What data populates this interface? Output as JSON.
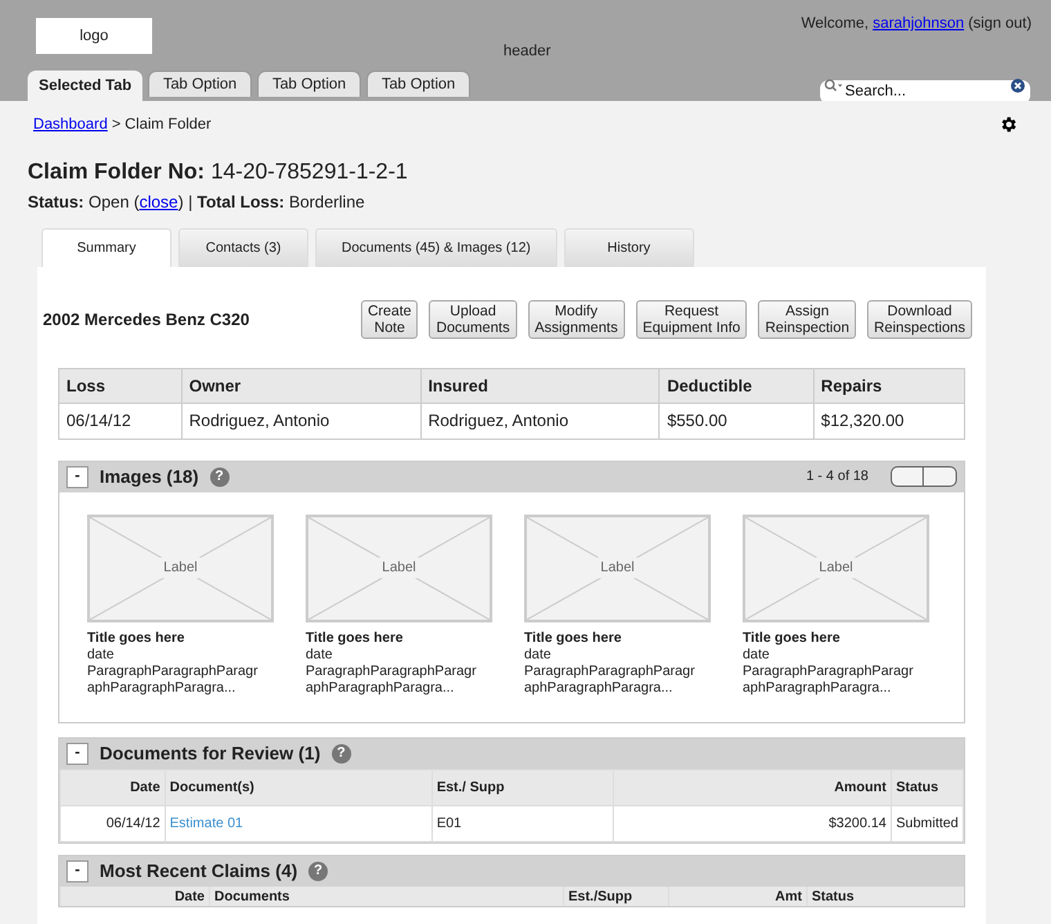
{
  "header": {
    "logo": "logo",
    "label": "header",
    "welcome": "Welcome,",
    "user": "sarahjohnson",
    "sign_out": "(sign out)"
  },
  "nav_tabs": [
    {
      "label": "Selected Tab",
      "selected": true
    },
    {
      "label": "Tab Option",
      "selected": false
    },
    {
      "label": "Tab Option",
      "selected": false
    },
    {
      "label": "Tab Option",
      "selected": false
    }
  ],
  "search": {
    "placeholder": "Search..."
  },
  "breadcrumb": {
    "link": "Dashboard",
    "current": "> Claim Folder"
  },
  "claim": {
    "title_label": "Claim Folder No:",
    "number": "14-20-785291-1-2-1",
    "status_label": "Status:",
    "status": "Open",
    "open_paren": "(",
    "close_link": "close",
    "close_paren": ")  |",
    "total_loss_label": "Total Loss:",
    "total_loss": "Borderline"
  },
  "tabs": [
    {
      "label": "Summary",
      "selected": true
    },
    {
      "label": "Contacts (3)",
      "selected": false
    },
    {
      "label": "Documents (45) & Images (12)",
      "selected": false
    },
    {
      "label": "History",
      "selected": false
    }
  ],
  "vehicle": "2002 Mercedes Benz C320",
  "actions": [
    [
      "Create",
      "Note"
    ],
    [
      "Upload",
      "Documents"
    ],
    [
      "Modify",
      "Assignments"
    ],
    [
      "Request",
      "Equipment Info"
    ],
    [
      "Assign",
      "Reinspection"
    ],
    [
      "Download",
      "Reinspections"
    ]
  ],
  "summary_table": {
    "columns": [
      "Loss",
      "Owner",
      "Insured",
      "Deductible",
      "Repairs"
    ],
    "rows": [
      [
        "06/14/12",
        "Rodriguez, Antonio",
        "Rodriguez, Antonio",
        "$550.00",
        "$12,320.00"
      ]
    ]
  },
  "images_panel": {
    "toggle": "-",
    "title": "Images (18)",
    "help": "?",
    "paging": "1 - 4 of 18",
    "items": [
      {
        "label": "Label",
        "title": "Title goes here",
        "date": "date",
        "text": "ParagraphParagraphParagraphParagraphParagra..."
      },
      {
        "label": "Label",
        "title": "Title goes here",
        "date": "date",
        "text": "ParagraphParagraphParagraphParagraphParagra..."
      },
      {
        "label": "Label",
        "title": "Title goes here",
        "date": "date",
        "text": "ParagraphParagraphParagraphParagraphParagra..."
      },
      {
        "label": "Label",
        "title": "Title goes here",
        "date": "date",
        "text": "ParagraphParagraphParagraphParagraphParagra..."
      }
    ]
  },
  "documents_panel": {
    "toggle": "-",
    "title": "Documents for Review (1)",
    "help": "?",
    "columns": [
      "Date",
      "Document(s)",
      "Est./ Supp",
      "Amount",
      "Status"
    ],
    "rows": [
      [
        "06/14/12",
        "Estimate 01",
        "E01",
        "$3200.14",
        "Submitted"
      ]
    ]
  },
  "claims_panel": {
    "toggle": "-",
    "title": "Most Recent Claims (4)",
    "help": "?",
    "columns": [
      "Date",
      "Documents",
      "Est./Supp",
      "Amt",
      "Status"
    ]
  }
}
